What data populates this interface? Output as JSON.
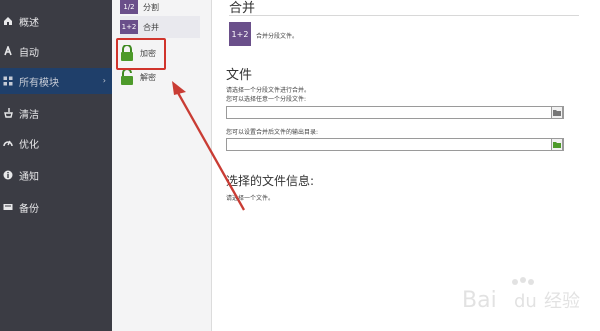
{
  "sidebar": {
    "items": [
      {
        "label": "概述",
        "icon": "home-icon"
      },
      {
        "label": "自动",
        "icon": "auto-icon"
      },
      {
        "label": "所有模块",
        "icon": "grid-icon",
        "active": true
      },
      {
        "label": "清洁",
        "icon": "broom-icon"
      },
      {
        "label": "优化",
        "icon": "speed-icon"
      },
      {
        "label": "通知",
        "icon": "info-icon"
      },
      {
        "label": "备份",
        "icon": "backup-icon"
      }
    ]
  },
  "subpanel": {
    "items": [
      {
        "label": "分割",
        "badge": "1/2"
      },
      {
        "label": "合并",
        "badge": "1+2"
      },
      {
        "label": "加密",
        "icon": "lock-icon"
      },
      {
        "label": "解密",
        "icon": "unlock-icon"
      }
    ]
  },
  "main": {
    "title": "合并",
    "badge": "1+2",
    "description": "合并分段文件。",
    "file_section": {
      "title": "文件",
      "line1": "请选择一个分段文件进行合并。",
      "line2": "您可以选择任意一个分段文件:",
      "input1_value": "",
      "line3": "您可以设置合并后文件的输出目录:",
      "input2_value": ""
    },
    "info_section": {
      "title": "选择的文件信息:",
      "text": "请选择一个文件。"
    }
  },
  "watermark": {
    "text": "Bai 经验"
  },
  "colors": {
    "sidebar_bg": "#3b3c44",
    "sidebar_active": "#1f3f6a",
    "accent_purple": "#6a4f8a",
    "highlight_red": "#d0342c",
    "lock_green": "#4d9a2a"
  }
}
